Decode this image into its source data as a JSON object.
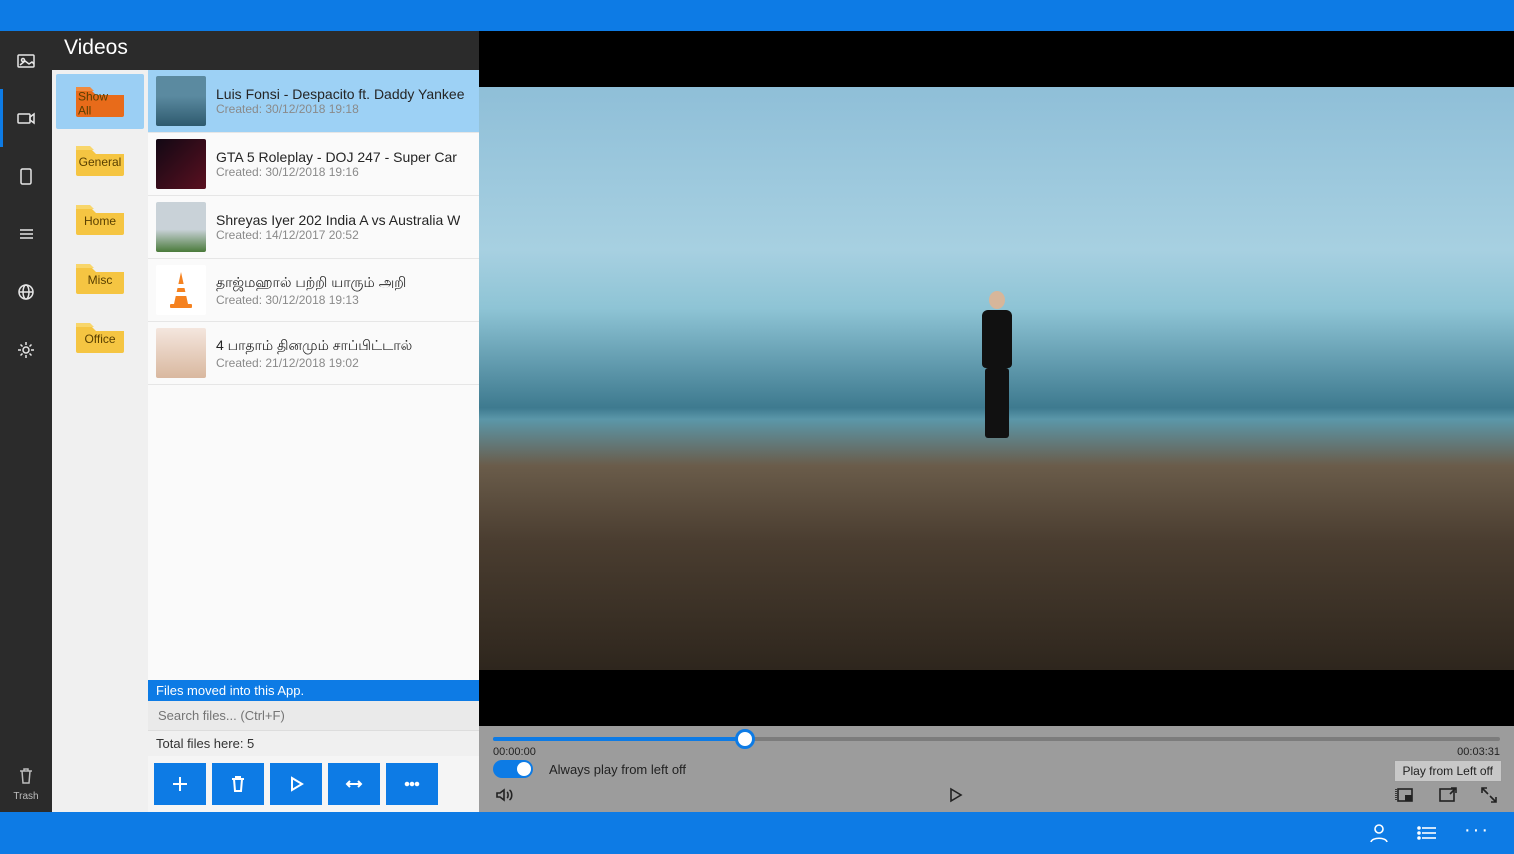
{
  "titlebar": {
    "title": ""
  },
  "rail": {
    "trash_label": "Trash"
  },
  "library": {
    "title": "Videos",
    "folders": [
      {
        "label": "Show All",
        "selected": true,
        "color": "#e86b1a"
      },
      {
        "label": "General",
        "selected": false,
        "color": "#f5c542"
      },
      {
        "label": "Home",
        "selected": false,
        "color": "#f5c542"
      },
      {
        "label": "Misc",
        "selected": false,
        "color": "#f5c542"
      },
      {
        "label": "Office",
        "selected": false,
        "color": "#f5c542"
      }
    ],
    "files": [
      {
        "title": "Luis Fonsi - Despacito ft. Daddy Yankee",
        "created_label": "Created: 30/12/2018 19:18",
        "selected": true
      },
      {
        "title": "GTA 5 Roleplay - DOJ 247 - Super Car",
        "created_label": "Created: 30/12/2018 19:16",
        "selected": false
      },
      {
        "title": "Shreyas Iyer 202  India A vs Australia W",
        "created_label": "Created: 14/12/2017 20:52",
        "selected": false
      },
      {
        "title": "தாஜ்மஹால் பற்றி யாரும் அறி",
        "created_label": "Created: 30/12/2018 19:13",
        "selected": false
      },
      {
        "title": "4 பாதாம் தினமும் சாப்பிட்டால்",
        "created_label": "Created: 21/12/2018 19:02",
        "selected": false
      }
    ],
    "status_message": "Files moved into this App.",
    "search_placeholder": "Search files... (Ctrl+F)",
    "total_label": "Total files here: 5"
  },
  "player": {
    "current_time": "00:00:00",
    "total_time": "00:03:31",
    "progress_percent": 25,
    "always_play_label": "Always play from left off",
    "tooltip": "Play from Left off"
  }
}
